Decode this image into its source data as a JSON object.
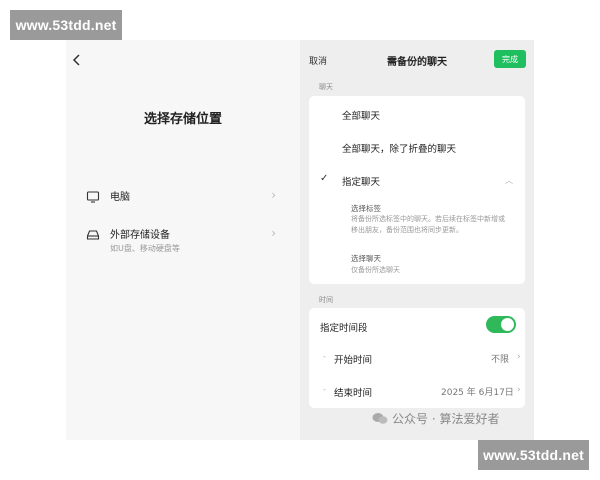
{
  "watermarks": {
    "top": "www.53tdd.net",
    "bottom": "www.53tdd.net"
  },
  "left_panel": {
    "back_icon": "chevron-left-icon",
    "title": "选择存储位置",
    "locations": [
      {
        "icon": "monitor-icon",
        "title": "电脑",
        "subtitle": ""
      },
      {
        "icon": "drive-icon",
        "title": "外部存储设备",
        "subtitle": "如U盘、移动硬盘等"
      }
    ]
  },
  "right_panel": {
    "cancel": "取消",
    "title": "需备份的聊天",
    "done": "完成",
    "chat_section_label": "聊天",
    "options": [
      {
        "label": "全部聊天",
        "checked": false
      },
      {
        "label": "全部聊天，除了折叠的聊天",
        "checked": false
      },
      {
        "label": "指定聊天",
        "checked": true
      }
    ],
    "sub_options": [
      {
        "title": "选择标签",
        "desc": "将备份所选标签中的聊天。若后续在标签中新增或移出朋友，备份范围也将同步更新。"
      },
      {
        "title": "选择聊天",
        "desc": "仅备份所选聊天"
      }
    ],
    "time_section_label": "时间",
    "time_toggle_label": "指定时间段",
    "time_toggle_on": true,
    "start_label": "开始时间",
    "start_value": "不限",
    "end_label": "结束时间",
    "end_value": "2025 年 6月17日"
  },
  "footer_watermark": "公众号 · 算法爱好者",
  "colors": {
    "accent_green": "#1fbf5f",
    "toggle_green": "#2fb95a"
  }
}
